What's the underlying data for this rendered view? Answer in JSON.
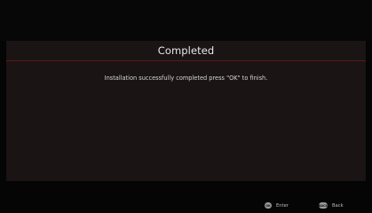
{
  "dialog": {
    "title": "Completed",
    "message": "Installation successfully completed press \"OK\" to finish."
  },
  "hints": {
    "enter": {
      "key": "OK",
      "label": "Enter",
      "icon": "ok-key-icon"
    },
    "back": {
      "key": "BACK",
      "label": "Back",
      "icon": "back-key-icon"
    }
  },
  "colors": {
    "background": "#050505",
    "panel": "#1a1414",
    "divider": "#5a1a1a",
    "text": "#e8e8e8"
  }
}
